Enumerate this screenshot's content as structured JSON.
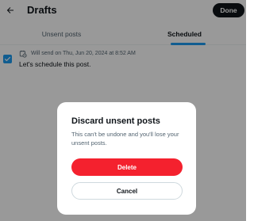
{
  "header": {
    "title": "Drafts",
    "done_label": "Done",
    "back_icon": "arrow-left-icon"
  },
  "tabs": [
    {
      "label": "Unsent posts",
      "selected": false
    },
    {
      "label": "Scheduled",
      "selected": true
    }
  ],
  "drafts": [
    {
      "checked": true,
      "schedule_icon": "calendar-clock-icon",
      "scheduled_text": "Will send on Thu, Jun 20, 2024 at 8:52 AM",
      "text": "Let's schedule this post."
    }
  ],
  "dialog": {
    "title": "Discard unsent posts",
    "body": "This can't be undone and you'll lose your unsent posts.",
    "delete_label": "Delete",
    "cancel_label": "Cancel"
  },
  "colors": {
    "accent": "#1d9bf0",
    "danger": "#f4212e",
    "text_primary": "#0f1419",
    "text_secondary": "#536471",
    "overlay": "rgba(0,0,0,0.4)"
  }
}
